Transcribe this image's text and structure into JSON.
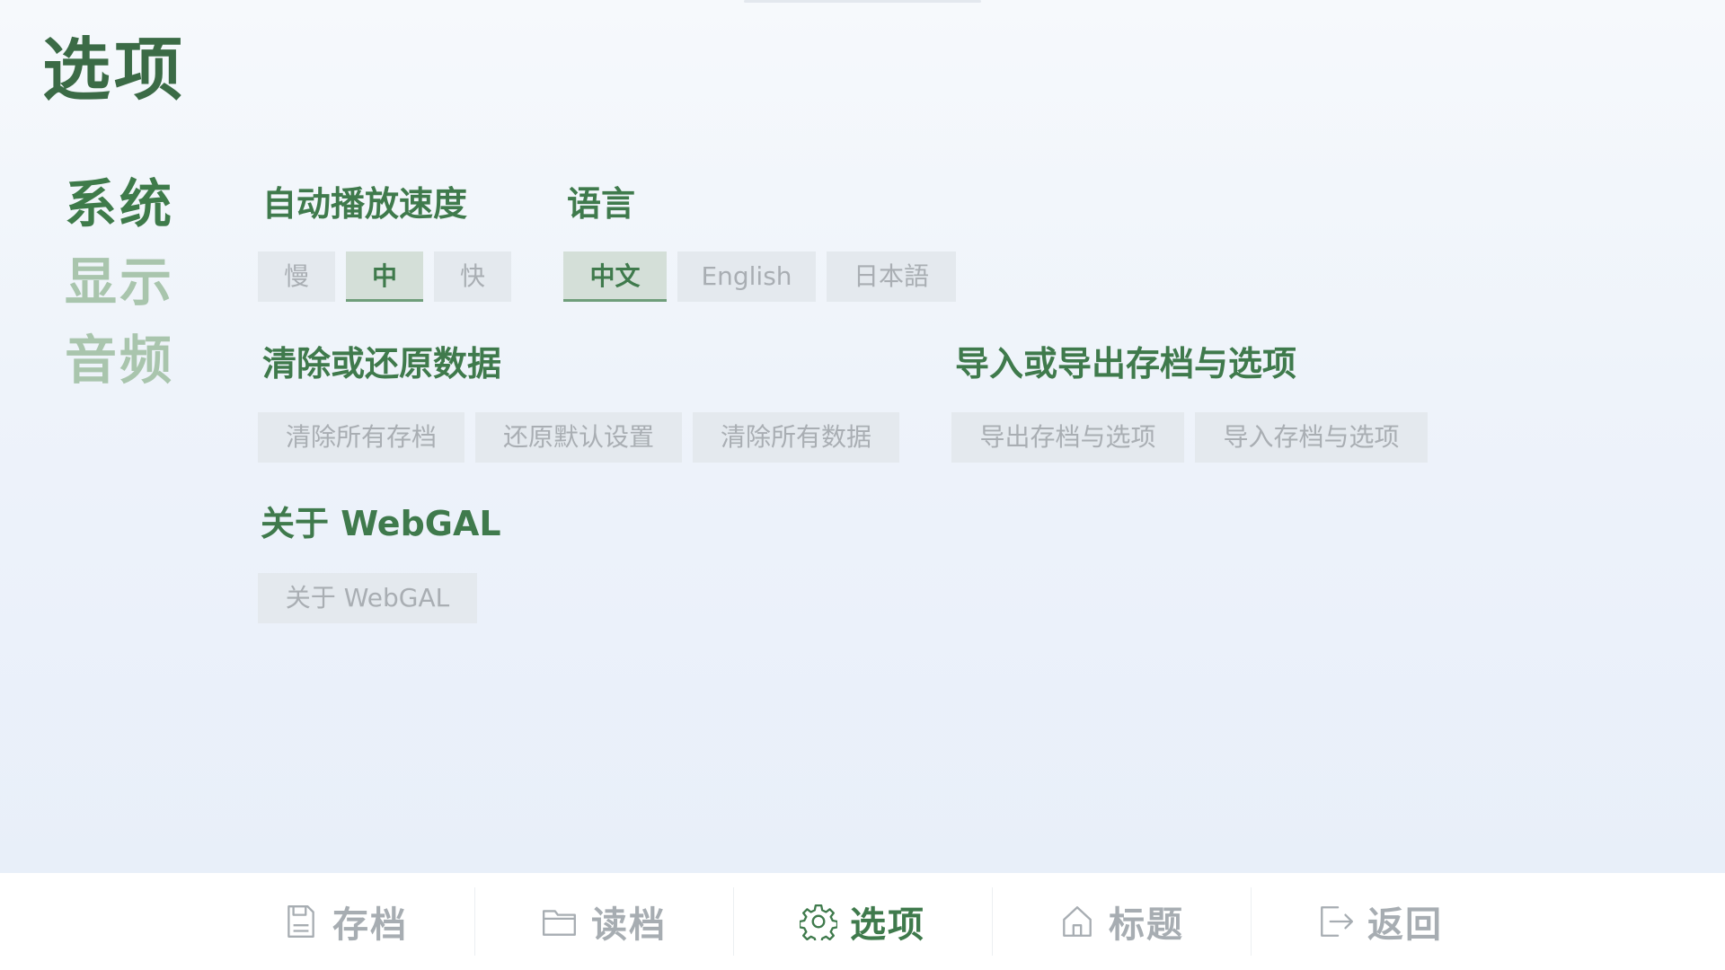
{
  "page_title": "选项",
  "side_tabs": [
    {
      "label": "系统",
      "active": true
    },
    {
      "label": "显示",
      "active": false
    },
    {
      "label": "音频",
      "active": false
    }
  ],
  "autoplay": {
    "title": "自动播放速度",
    "options": [
      "慢",
      "中",
      "快"
    ],
    "selected": "中"
  },
  "language": {
    "title": "语言",
    "options": [
      "中文",
      "English",
      "日本語"
    ],
    "selected": "中文"
  },
  "clear_data": {
    "title": "清除或还原数据",
    "buttons": [
      "清除所有存档",
      "还原默认设置",
      "清除所有数据"
    ]
  },
  "import_export": {
    "title": "导入或导出存档与选项",
    "buttons": [
      "导出存档与选项",
      "导入存档与选项"
    ]
  },
  "about": {
    "title": "关于 WebGAL",
    "button": "关于 WebGAL"
  },
  "bottom_nav": [
    {
      "label": "存档",
      "icon": "save-icon",
      "active": false
    },
    {
      "label": "读档",
      "icon": "folder-icon",
      "active": false
    },
    {
      "label": "选项",
      "icon": "gear-icon",
      "active": true
    },
    {
      "label": "标题",
      "icon": "home-icon",
      "active": false
    },
    {
      "label": "返回",
      "icon": "exit-icon",
      "active": false
    }
  ],
  "colors": {
    "accent": "#3f7a4c",
    "inactive_tab": "#a9c5ad",
    "button_bg": "#e4e9ee",
    "button_text": "#a9aeb3"
  }
}
